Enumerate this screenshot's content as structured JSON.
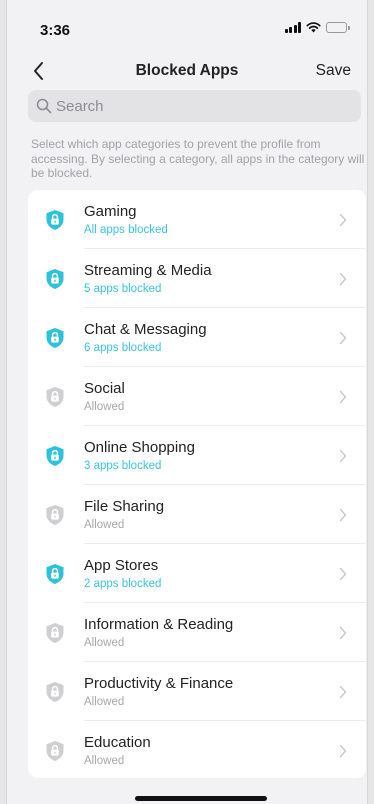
{
  "status_bar": {
    "time": "3:36"
  },
  "nav": {
    "title": "Blocked Apps",
    "save_label": "Save"
  },
  "search": {
    "placeholder": "Search"
  },
  "description": "Select which app categories to prevent the profile from accessing. By selecting a category, all apps in the category will be blocked.",
  "colors": {
    "accent": "#3cc3dd",
    "blocked_icon": "#2dc2dc",
    "allowed_icon": "#cfcfd2"
  },
  "categories": [
    {
      "name": "Gaming",
      "status": "All apps blocked",
      "blocked": true,
      "icon": "lock-shield-icon"
    },
    {
      "name": "Streaming & Media",
      "status": "5 apps blocked",
      "blocked": true,
      "icon": "lock-shield-icon"
    },
    {
      "name": "Chat & Messaging",
      "status": "6 apps blocked",
      "blocked": true,
      "icon": "lock-shield-icon"
    },
    {
      "name": "Social",
      "status": "Allowed",
      "blocked": false,
      "icon": "lock-shield-icon"
    },
    {
      "name": "Online Shopping",
      "status": "3 apps blocked",
      "blocked": true,
      "icon": "lock-shield-icon"
    },
    {
      "name": "File Sharing",
      "status": "Allowed",
      "blocked": false,
      "icon": "lock-shield-icon"
    },
    {
      "name": "App Stores",
      "status": "2 apps blocked",
      "blocked": true,
      "icon": "lock-shield-icon"
    },
    {
      "name": "Information & Reading",
      "status": "Allowed",
      "blocked": false,
      "icon": "lock-shield-icon"
    },
    {
      "name": "Productivity & Finance",
      "status": "Allowed",
      "blocked": false,
      "icon": "lock-shield-icon"
    },
    {
      "name": "Education",
      "status": "Allowed",
      "blocked": false,
      "icon": "lock-shield-icon"
    }
  ]
}
